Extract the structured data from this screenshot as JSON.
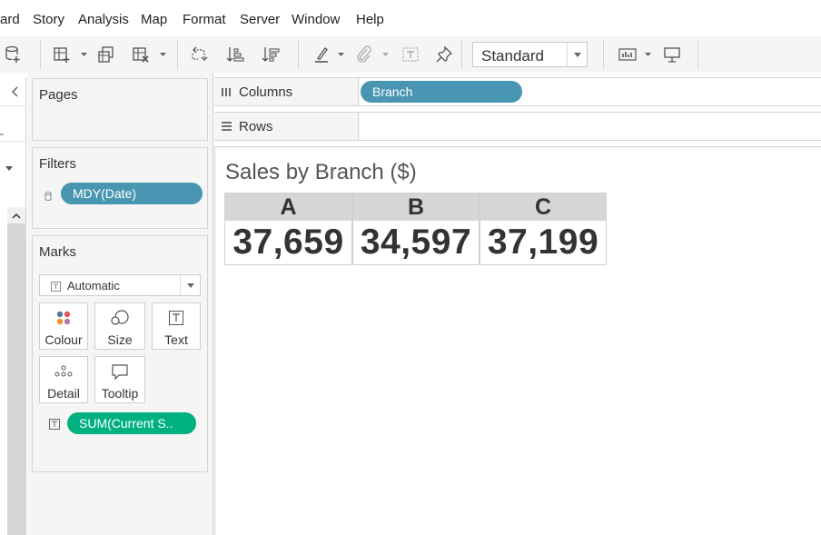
{
  "menu": [
    "ard",
    "Story",
    "Analysis",
    "Map",
    "Format",
    "Server",
    "Window",
    "Help"
  ],
  "toolbar": {
    "view_mode": "Standard",
    "icons": [
      "new-datasource-icon",
      "new-worksheet-icon",
      "duplicate-sheet-icon",
      "clear-sheet-icon",
      "swap-icon",
      "sort-ascending-icon",
      "sort-descending-icon",
      "highlight-icon",
      "group-icon",
      "labels-icon",
      "pin-icon",
      "show-me-icon",
      "presentation-icon"
    ]
  },
  "panels": {
    "pages": {
      "title": "Pages"
    },
    "filters": {
      "title": "Filters",
      "pill": "MDY(Date)"
    },
    "marks": {
      "title": "Marks",
      "type": "Automatic",
      "buttons": [
        "Colour",
        "Size",
        "Text",
        "Detail",
        "Tooltip"
      ],
      "pill": "SUM(Current S.."
    }
  },
  "shelves": {
    "columns": {
      "label": "Columns",
      "pill": "Branch"
    },
    "rows": {
      "label": "Rows"
    }
  },
  "view": {
    "title": "Sales by Branch ($)",
    "headers": [
      "A",
      "B",
      "C"
    ],
    "values": [
      "37,659",
      "34,597",
      "37,199"
    ]
  },
  "chart_data": {
    "type": "table",
    "title": "Sales by Branch ($)",
    "categories": [
      "A",
      "B",
      "C"
    ],
    "values": [
      37659,
      34597,
      37199
    ]
  },
  "colors": {
    "dimension_pill": "#4996b2",
    "measure_pill": "#00b180",
    "header_bg": "#d6d6d6",
    "panel_bg": "#f5f5f5"
  }
}
